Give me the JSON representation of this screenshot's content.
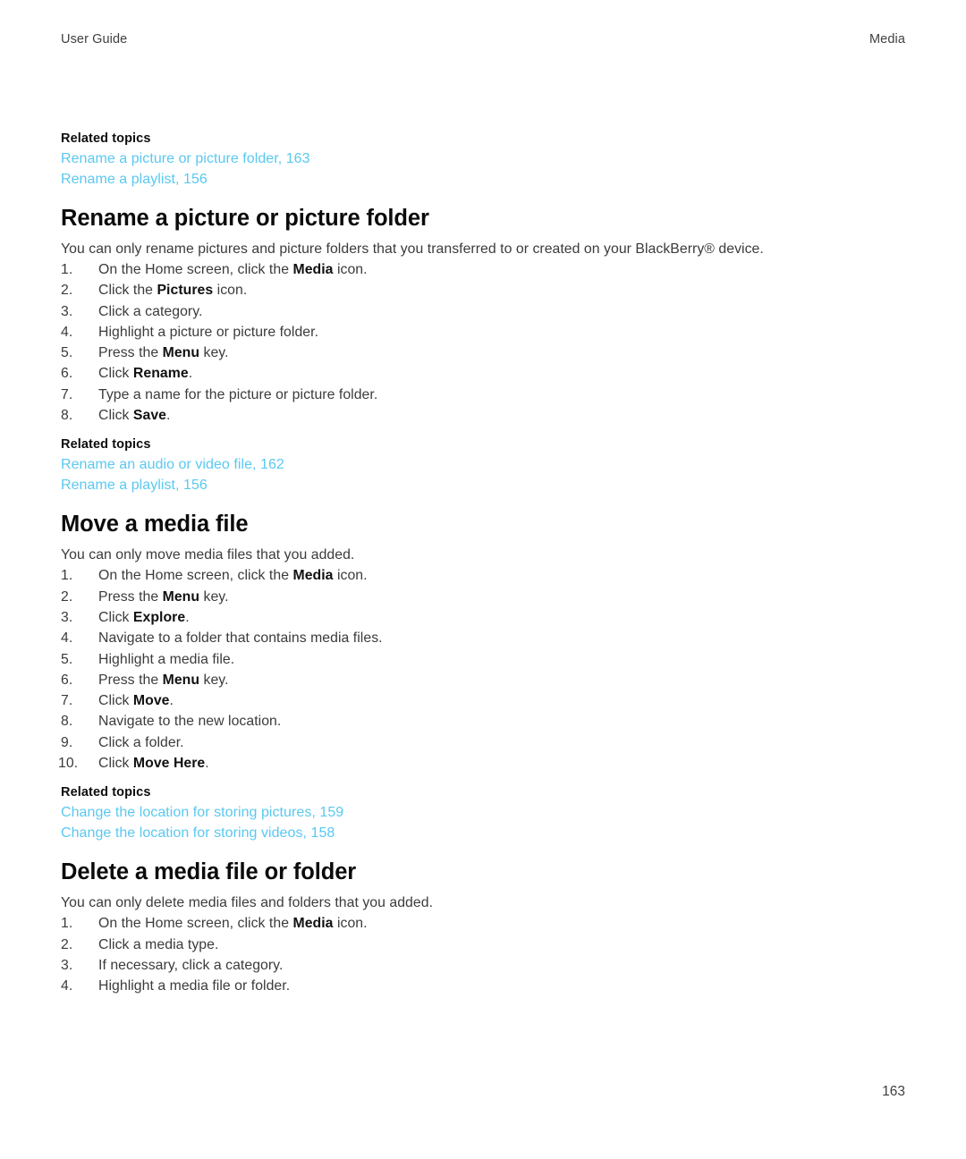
{
  "running_head": {
    "left": "User Guide",
    "right": "Media"
  },
  "colors": {
    "link": "#5ac8f0",
    "heading": "#0b0b0b",
    "body": "#3b3b3b",
    "page_background": "#ffffff"
  },
  "related_label": "Related topics",
  "blocks": {
    "related_top": {
      "label": "Related topics",
      "links": [
        "Rename a picture or picture folder, 163",
        "Rename a playlist, 156"
      ]
    },
    "rename_picture": {
      "title": "Rename a picture or picture folder",
      "intro": "You can only rename pictures and picture folders that you transferred to or created on your BlackBerry® device.",
      "steps": [
        {
          "num": "1.",
          "parts": [
            {
              "t": "On the Home screen, click the ",
              "b": false
            },
            {
              "t": "Media",
              "b": true
            },
            {
              "t": " icon.",
              "b": false
            }
          ]
        },
        {
          "num": "2.",
          "parts": [
            {
              "t": "Click the ",
              "b": false
            },
            {
              "t": "Pictures",
              "b": true
            },
            {
              "t": " icon.",
              "b": false
            }
          ]
        },
        {
          "num": "3.",
          "parts": [
            {
              "t": "Click a category.",
              "b": false
            }
          ]
        },
        {
          "num": "4.",
          "parts": [
            {
              "t": "Highlight a picture or picture folder.",
              "b": false
            }
          ]
        },
        {
          "num": "5.",
          "parts": [
            {
              "t": "Press the ",
              "b": false
            },
            {
              "t": "Menu",
              "b": true
            },
            {
              "t": " key.",
              "b": false
            }
          ]
        },
        {
          "num": "6.",
          "parts": [
            {
              "t": "Click ",
              "b": false
            },
            {
              "t": "Rename",
              "b": true
            },
            {
              "t": ".",
              "b": false
            }
          ]
        },
        {
          "num": "7.",
          "parts": [
            {
              "t": "Type a name for the picture or picture folder.",
              "b": false
            }
          ]
        },
        {
          "num": "8.",
          "parts": [
            {
              "t": "Click ",
              "b": false
            },
            {
              "t": "Save",
              "b": true
            },
            {
              "t": ".",
              "b": false
            }
          ]
        }
      ],
      "related": {
        "label": "Related topics",
        "links": [
          "Rename an audio or video file, 162",
          "Rename a playlist, 156"
        ]
      }
    },
    "move_media": {
      "title": "Move a media file",
      "intro": "You can only move media files that you added.",
      "steps": [
        {
          "num": "1.",
          "parts": [
            {
              "t": "On the Home screen, click the ",
              "b": false
            },
            {
              "t": "Media",
              "b": true
            },
            {
              "t": " icon.",
              "b": false
            }
          ]
        },
        {
          "num": "2.",
          "parts": [
            {
              "t": "Press the ",
              "b": false
            },
            {
              "t": "Menu",
              "b": true
            },
            {
              "t": " key.",
              "b": false
            }
          ]
        },
        {
          "num": "3.",
          "parts": [
            {
              "t": "Click ",
              "b": false
            },
            {
              "t": "Explore",
              "b": true
            },
            {
              "t": ".",
              "b": false
            }
          ]
        },
        {
          "num": "4.",
          "parts": [
            {
              "t": "Navigate to a folder that contains media files.",
              "b": false
            }
          ]
        },
        {
          "num": "5.",
          "parts": [
            {
              "t": "Highlight a media file.",
              "b": false
            }
          ]
        },
        {
          "num": "6.",
          "parts": [
            {
              "t": "Press the ",
              "b": false
            },
            {
              "t": "Menu",
              "b": true
            },
            {
              "t": " key.",
              "b": false
            }
          ]
        },
        {
          "num": "7.",
          "parts": [
            {
              "t": "Click ",
              "b": false
            },
            {
              "t": "Move",
              "b": true
            },
            {
              "t": ".",
              "b": false
            }
          ]
        },
        {
          "num": "8.",
          "parts": [
            {
              "t": "Navigate to the new location.",
              "b": false
            }
          ]
        },
        {
          "num": "9.",
          "parts": [
            {
              "t": "Click a folder.",
              "b": false
            }
          ]
        },
        {
          "num": "10.",
          "parts": [
            {
              "t": "Click ",
              "b": false
            },
            {
              "t": "Move Here",
              "b": true
            },
            {
              "t": ".",
              "b": false
            }
          ]
        }
      ],
      "related": {
        "label": "Related topics",
        "links": [
          "Change the location for storing pictures, 159",
          "Change the location for storing videos, 158"
        ]
      }
    },
    "delete_media": {
      "title": "Delete a media file or folder",
      "intro": "You can only delete media files and folders that you added.",
      "steps": [
        {
          "num": "1.",
          "parts": [
            {
              "t": "On the Home screen, click the ",
              "b": false
            },
            {
              "t": "Media",
              "b": true
            },
            {
              "t": " icon.",
              "b": false
            }
          ]
        },
        {
          "num": "2.",
          "parts": [
            {
              "t": "Click a media type.",
              "b": false
            }
          ]
        },
        {
          "num": "3.",
          "parts": [
            {
              "t": "If necessary, click a category.",
              "b": false
            }
          ]
        },
        {
          "num": "4.",
          "parts": [
            {
              "t": "Highlight a media file or folder.",
              "b": false
            }
          ]
        }
      ]
    }
  },
  "page_number": "163"
}
